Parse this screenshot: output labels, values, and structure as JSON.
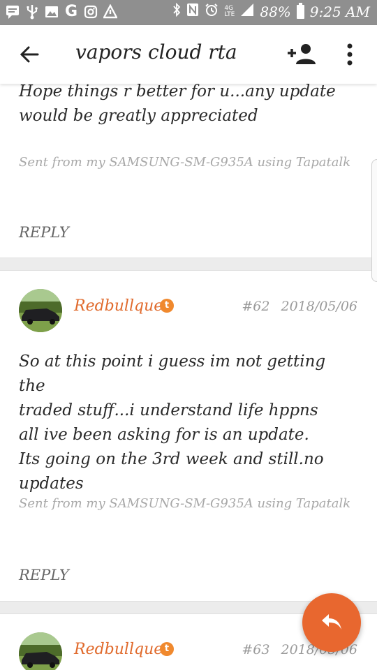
{
  "status_bar": {
    "left_icons": [
      "message-icon",
      "usb-icon",
      "gallery-icon",
      "google-icon",
      "instagram-icon",
      "alert-icon"
    ],
    "right_icons": [
      "bluetooth-icon",
      "nfc-icon",
      "alarm-icon",
      "lte-icon",
      "signal-icon"
    ],
    "battery": "88%",
    "time": "9:25 AM"
  },
  "app_bar": {
    "title": "vapors cloud rta"
  },
  "posts": [
    {
      "body": "Hope things r better for u...any update would be greatly appreciated",
      "signature": "Sent from my SAMSUNG-SM-G935A using Tapatalk",
      "reply_label": "REPLY"
    },
    {
      "username": "Redbullque",
      "badge": "t",
      "number": "#62",
      "date": "2018/05/06",
      "body_lines": [
        "So at this point i guess im not getting the",
        "traded stuff...i understand life hppns",
        "all ive been asking for is an update.",
        "Its going on the 3rd week and still.no",
        "updates"
      ],
      "signature": "Sent from my SAMSUNG-SM-G935A using Tapatalk",
      "reply_label": "REPLY"
    },
    {
      "username": "Redbullque",
      "badge": "t",
      "number": "#63",
      "date": "2018/05/06"
    }
  ],
  "colors": {
    "accent": "#e8672f",
    "username": "#e06a2c",
    "status_bar": "#8f8f8f"
  }
}
